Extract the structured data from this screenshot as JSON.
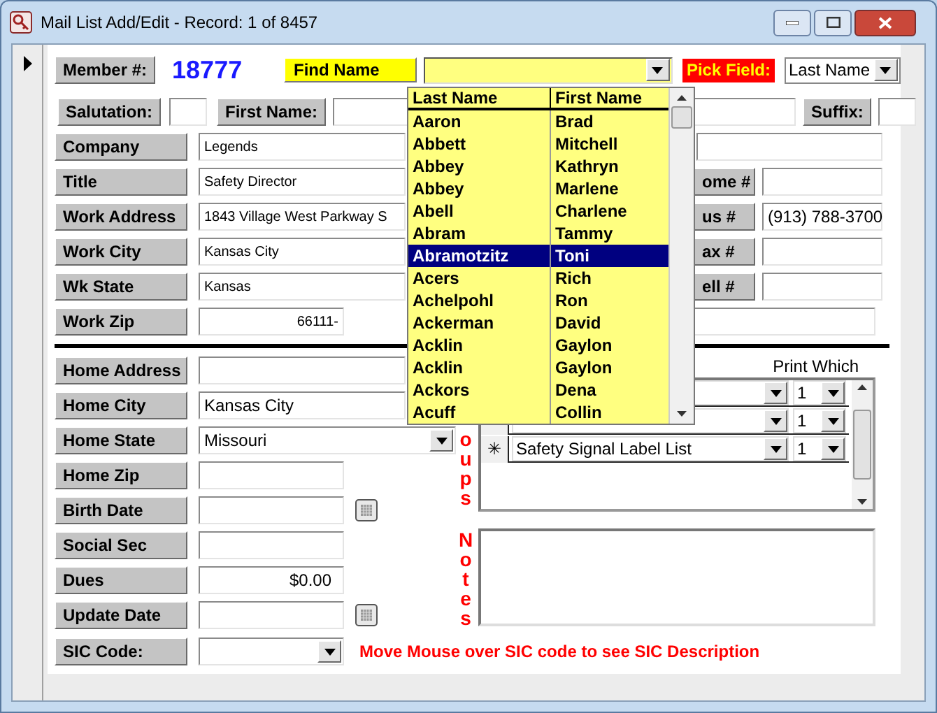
{
  "window": {
    "title": "Mail List Add/Edit - Record: 1 of 8457"
  },
  "header": {
    "member_label": "Member #:",
    "member_number": "18777",
    "find_label": "Find Name",
    "pick_label": "Pick Field:",
    "pick_value": "Last Name"
  },
  "name_row": {
    "salutation_label": "Salutation:",
    "first_name_label": "First Name:",
    "suffix_label": "Suffix:"
  },
  "work_fields": [
    {
      "label": "Company",
      "value": "Legends"
    },
    {
      "label": "Title",
      "value": "Safety Director"
    },
    {
      "label": "Work Address",
      "value": "1843 Village West Parkway S"
    },
    {
      "label": "Work City",
      "value": "Kansas City"
    },
    {
      "label": "Wk State",
      "value": "Kansas"
    },
    {
      "label": "Work Zip",
      "value": "66111-"
    }
  ],
  "phone_fields": [
    {
      "label": "ome #"
    },
    {
      "label": "us #",
      "value": "(913) 788-3700"
    },
    {
      "label": "ax #"
    },
    {
      "label": "ell #"
    }
  ],
  "home_fields": [
    {
      "label": "Home Address",
      "kind": "text"
    },
    {
      "label": "Home City",
      "kind": "text",
      "value": "Kansas City"
    },
    {
      "label": "Home State",
      "kind": "combo",
      "value": "Missouri"
    },
    {
      "label": "Home Zip",
      "kind": "short"
    },
    {
      "label": "Birth Date",
      "kind": "date"
    },
    {
      "label": "Social Sec",
      "kind": "short"
    },
    {
      "label": "Dues",
      "kind": "money",
      "value": "$0.00"
    },
    {
      "label": "Update Date",
      "kind": "date"
    }
  ],
  "sic": {
    "label": "SIC Code:",
    "hint": "Move Mouse over SIC code to see SIC Description"
  },
  "groups": {
    "label": "oups",
    "print_label": "Print Which",
    "rows": [
      {
        "copies": "1"
      },
      {
        "copies": "1"
      },
      {
        "selector": "✳",
        "name": "Safety Signal Label List",
        "copies": "1"
      }
    ]
  },
  "notes": {
    "label": "Notes"
  },
  "find_dropdown": {
    "columns": [
      "Last Name",
      "First Name"
    ],
    "rows": [
      {
        "last": "Aaron",
        "first": "Brad",
        "selected": false
      },
      {
        "last": "Abbett",
        "first": "Mitchell",
        "selected": false
      },
      {
        "last": "Abbey",
        "first": "Kathryn",
        "selected": false
      },
      {
        "last": "Abbey",
        "first": "Marlene",
        "selected": false
      },
      {
        "last": "Abell",
        "first": "Charlene",
        "selected": false
      },
      {
        "last": "Abram",
        "first": "Tammy",
        "selected": false
      },
      {
        "last": "Abramotzitz",
        "first": "Toni",
        "selected": true
      },
      {
        "last": "Acers",
        "first": "Rich",
        "selected": false
      },
      {
        "last": "Achelpohl",
        "first": "Ron",
        "selected": false
      },
      {
        "last": "Ackerman",
        "first": "David",
        "selected": false
      },
      {
        "last": "Acklin",
        "first": "Gaylon",
        "selected": false
      },
      {
        "last": "Acklin",
        "first": "Gaylon",
        "selected": false
      },
      {
        "last": "Ackors",
        "first": "Dena",
        "selected": false
      },
      {
        "last": "Acuff",
        "first": "Collin",
        "selected": false
      }
    ]
  }
}
